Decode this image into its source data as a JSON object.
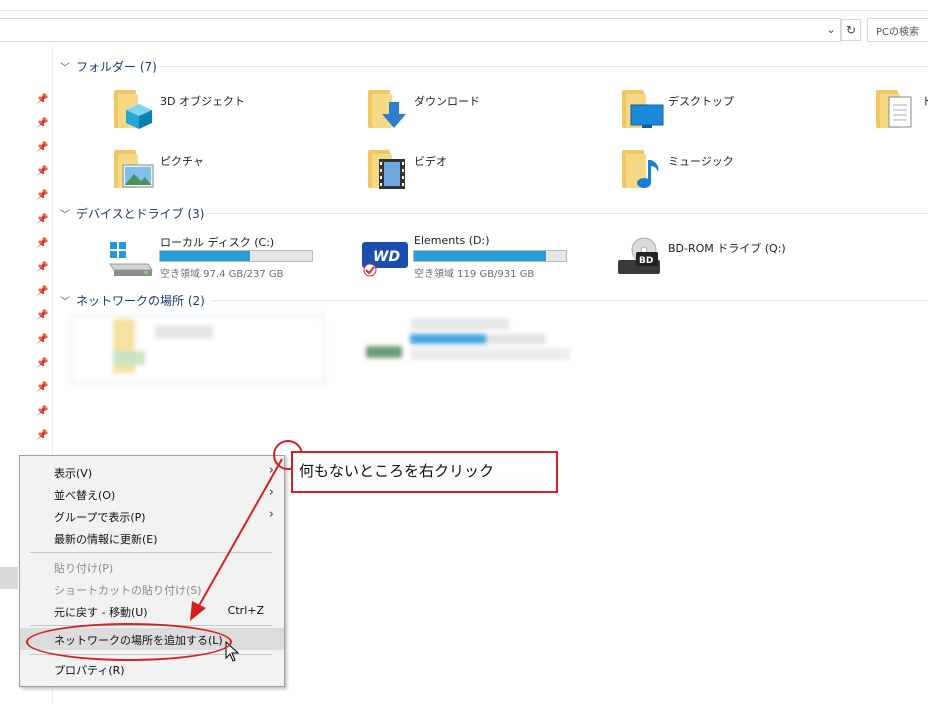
{
  "toolbar": {
    "search_placeholder": "PCの検索",
    "address_chevron": "⌄",
    "refresh": "↻"
  },
  "sections": {
    "folders": "フォルダー (7)",
    "devices": "デバイスとドライブ (3)",
    "network": "ネットワークの場所 (2)"
  },
  "folders": [
    {
      "label": "3D オブジェクト",
      "icon": "3d-objects-folder-icon"
    },
    {
      "label": "ダウンロード",
      "icon": "downloads-folder-icon"
    },
    {
      "label": "デスクトップ",
      "icon": "desktop-folder-icon"
    },
    {
      "label": "ド",
      "icon": "documents-folder-icon"
    },
    {
      "label": "ピクチャ",
      "icon": "pictures-folder-icon"
    },
    {
      "label": "ビデオ",
      "icon": "videos-folder-icon"
    },
    {
      "label": "ミュージック",
      "icon": "music-folder-icon"
    }
  ],
  "drives": [
    {
      "name": "ローカル ディスク (C:)",
      "space": "空き領域 97.4 GB/237 GB",
      "used_fraction": 0.59,
      "icon": "windows-drive-icon"
    },
    {
      "name": "Elements (D:)",
      "space": "空き領域 119 GB/931 GB",
      "used_fraction": 0.87,
      "icon": "wd-drive-icon"
    },
    {
      "name": "BD-ROM ドライブ (Q:)",
      "icon": "bd-rom-drive-icon"
    }
  ],
  "context_menu": {
    "items": [
      {
        "label": "表示(V)",
        "submenu": true
      },
      {
        "label": "並べ替え(O)",
        "submenu": true
      },
      {
        "label": "グループで表示(P)",
        "submenu": true
      },
      {
        "label": "最新の情報に更新(E)"
      },
      {
        "label": "貼り付け(P)",
        "disabled": true
      },
      {
        "label": "ショートカットの貼り付け(S)",
        "disabled": true
      },
      {
        "label": "元に戻す - 移動(U)",
        "shortcut": "Ctrl+Z"
      },
      {
        "label": "ネットワークの場所を追加する(L)",
        "highlighted": true
      },
      {
        "label": "プロパティ(R)"
      }
    ]
  },
  "annotation": {
    "text": "何もないところを右クリック",
    "color": "#d42020"
  },
  "colors": {
    "accent_bar": "#26a0da",
    "folder": "#f0c764",
    "section_text": "#1a3b6e"
  }
}
